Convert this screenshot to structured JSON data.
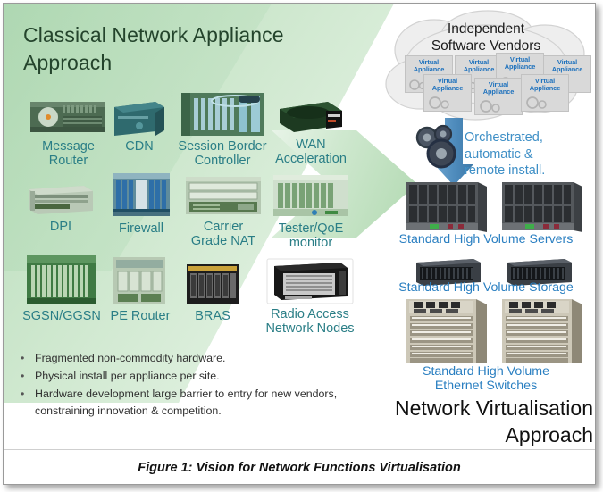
{
  "figure": {
    "caption": "Figure 1: Vision for Network Functions Virtualisation"
  },
  "left": {
    "title_line1": "Classical Network Appliance",
    "title_line2": "Approach",
    "label_color": "#2a7e86",
    "appliances": [
      {
        "name": "message-router",
        "label_line1": "Message",
        "label_line2": "Router"
      },
      {
        "name": "cdn",
        "label_line1": "CDN",
        "label_line2": ""
      },
      {
        "name": "session-border-controller",
        "label_line1": "Session Border",
        "label_line2": "Controller"
      },
      {
        "name": "wan-acceleration",
        "label_line1": "WAN",
        "label_line2": "Acceleration"
      },
      {
        "name": "dpi",
        "label_line1": "DPI",
        "label_line2": ""
      },
      {
        "name": "firewall",
        "label_line1": "Firewall",
        "label_line2": ""
      },
      {
        "name": "carrier-grade-nat",
        "label_line1": "Carrier",
        "label_line2": "Grade NAT"
      },
      {
        "name": "tester-qoe-monitor",
        "label_line1": "Tester/QoE",
        "label_line2": "monitor"
      },
      {
        "name": "sgsn-ggsn",
        "label_line1": "SGSN/GGSN",
        "label_line2": ""
      },
      {
        "name": "pe-router",
        "label_line1": "PE Router",
        "label_line2": ""
      },
      {
        "name": "bras",
        "label_line1": "BRAS",
        "label_line2": ""
      },
      {
        "name": "radio-access-network-nodes",
        "label_line1": "Radio Access",
        "label_line2": "Network Nodes"
      }
    ],
    "bullets": [
      "Fragmented non-commodity hardware.",
      "Physical install per appliance per site.",
      "Hardware development  large barrier to entry for new vendors, constraining innovation & competition."
    ],
    "bullet_marker": "•"
  },
  "right": {
    "isv_title_line1": "Independent",
    "isv_title_line2": "Software Vendors",
    "virtual_appliance_label_line1": "Virtual",
    "virtual_appliance_label_line2": "Appliance",
    "virtual_appliance_count": 7,
    "orchestration_line1": "Orchestrated,",
    "orchestration_line2": "automatic &",
    "orchestration_line3": "remote install.",
    "servers_label": "Standard High Volume Servers",
    "storage_label": "Standard High Volume Storage",
    "switches_label_line1": "Standard High Volume",
    "switches_label_line2": "Ethernet Switches",
    "nv_title_line1": "Network Virtualisation",
    "nv_title_line2": "Approach",
    "label_color": "#2a7fc1",
    "arrow_color": "#4a8fc4"
  }
}
